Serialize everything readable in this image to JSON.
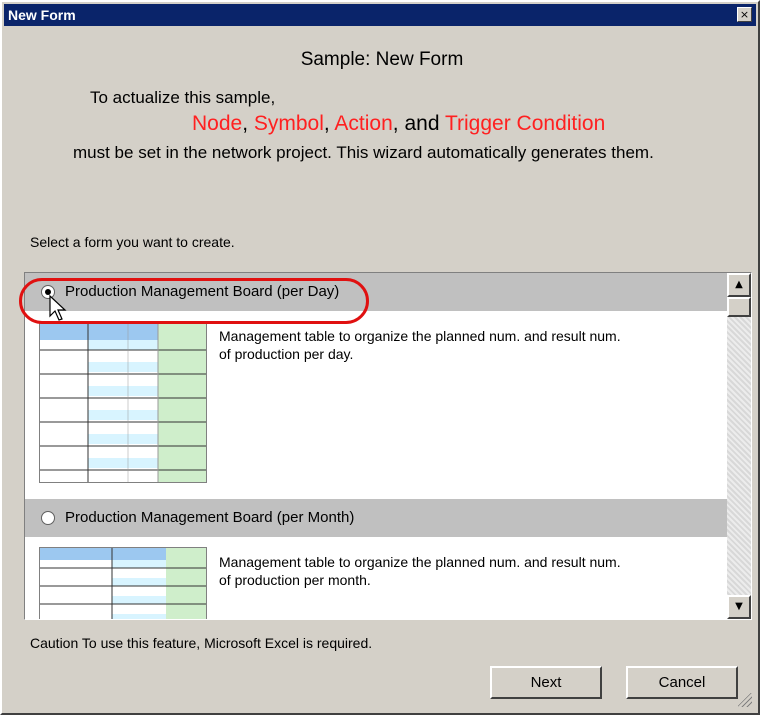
{
  "window": {
    "title": "New Form",
    "close_glyph": "×"
  },
  "dialog": {
    "heading": "Sample: New Form",
    "intro": "To actualize this sample,",
    "items": {
      "node": "Node",
      "symbol": "Symbol",
      "action": "Action",
      "trigger": "Trigger Condition"
    },
    "sep_comma": ", ",
    "and_text": ", and ",
    "must_text": "must be set in the network project. This wizard automatically generates them.",
    "select_label": "Select a form you want to create.",
    "options": [
      {
        "label": "Production Management Board (per Day)",
        "selected": true,
        "description_1": "Management table to organize the planned num. and result num.",
        "description_2": "of production per day."
      },
      {
        "label": "Production Management Board (per Month)",
        "selected": false,
        "description_1": "Management table to organize the planned num. and result num.",
        "description_2": "of production per month."
      }
    ],
    "caution": "Caution  To use this feature, Microsoft Excel is required.",
    "next_label": "Next",
    "cancel_label": "Cancel"
  },
  "scrollbar": {
    "up_glyph": "▲",
    "down_glyph": "▼"
  },
  "colors": {
    "accent_red": "#ff2020",
    "titlebar": "#0a246a",
    "highlight": "#e01010"
  }
}
